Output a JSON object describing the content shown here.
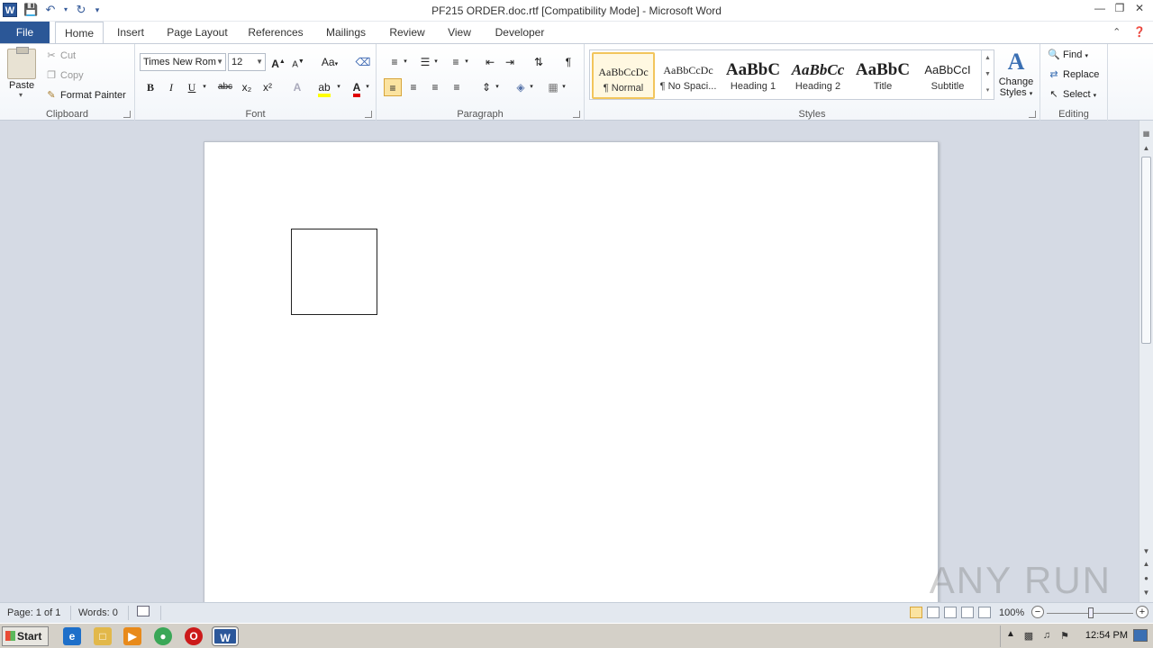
{
  "window": {
    "title": "PF215 ORDER.doc.rtf [Compatibility Mode]  -  Microsoft Word",
    "app_icon": "W"
  },
  "quick_access": {
    "save_icon": "save-icon",
    "undo_icon": "undo-icon",
    "redo_icon": "redo-icon"
  },
  "tabs": [
    {
      "label": "File"
    },
    {
      "label": "Home"
    },
    {
      "label": "Insert"
    },
    {
      "label": "Page Layout"
    },
    {
      "label": "References"
    },
    {
      "label": "Mailings"
    },
    {
      "label": "Review"
    },
    {
      "label": "View"
    },
    {
      "label": "Developer"
    }
  ],
  "clipboard": {
    "paste": "Paste",
    "cut": "Cut",
    "copy": "Copy",
    "format_painter": "Format Painter",
    "label": "Clipboard"
  },
  "font": {
    "name": "Times New Rom",
    "size": "12",
    "grow": "A",
    "shrink": "A",
    "change_case": "Aa",
    "bold": "B",
    "italic": "I",
    "underline": "U",
    "strikethrough": "abc",
    "subscript": "x₂",
    "superscript": "x²",
    "highlight_color": "#ffff00",
    "font_color": "#e00000",
    "label": "Font"
  },
  "paragraph": {
    "label": "Paragraph",
    "pilcrow": "¶"
  },
  "styles": {
    "label": "Styles",
    "items": [
      {
        "sample": "AaBbCcDc",
        "name": "¶ Normal"
      },
      {
        "sample": "AaBbCcDc",
        "name": "¶ No Spaci..."
      },
      {
        "sample": "AaBbC",
        "name": "Heading 1"
      },
      {
        "sample": "AaBbCc",
        "name": "Heading 2"
      },
      {
        "sample": "AaBbC",
        "name": "Title"
      },
      {
        "sample": "AaBbCcI",
        "name": "Subtitle"
      }
    ],
    "change_styles_line1": "Change",
    "change_styles_line2": "Styles"
  },
  "editing": {
    "label": "Editing",
    "find": "Find",
    "replace": "Replace",
    "select": "Select"
  },
  "status": {
    "page": "Page: 1 of 1",
    "words": "Words: 0",
    "zoom": "100%"
  },
  "watermark": "ANY RUN",
  "taskbar": {
    "start": "Start",
    "clock": "12:54 PM"
  }
}
